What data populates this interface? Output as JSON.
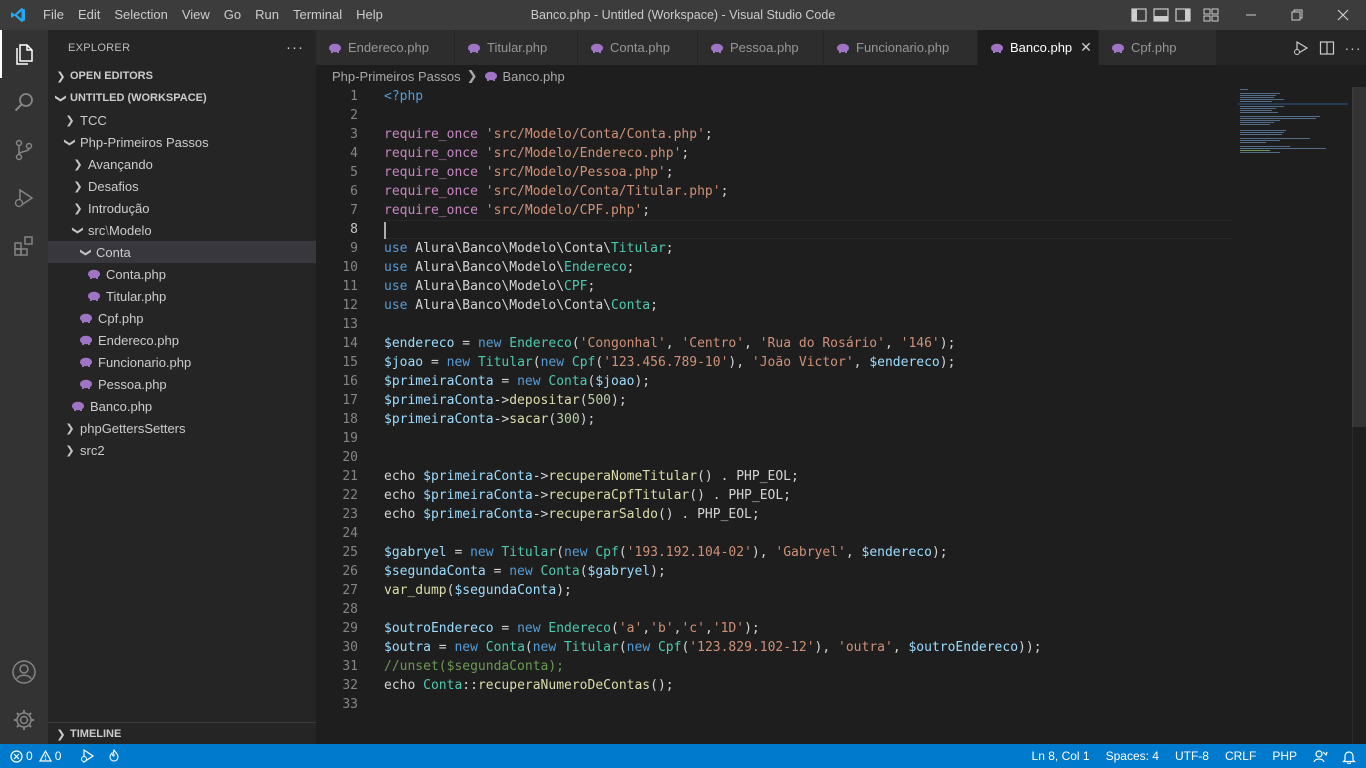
{
  "titlebar": {
    "menu": [
      "File",
      "Edit",
      "Selection",
      "View",
      "Go",
      "Run",
      "Terminal",
      "Help"
    ],
    "title": "Banco.php - Untitled (Workspace) - Visual Studio Code"
  },
  "sidebar": {
    "header": "EXPLORER",
    "open_editors": "OPEN EDITORS",
    "workspace": "UNTITLED (WORKSPACE)",
    "timeline": "TIMELINE",
    "tree": {
      "tcc": "TCC",
      "php_primeiros": "Php-Primeiros Passos",
      "avancando": "Avançando",
      "desafios": "Desafios",
      "introducao": "Introdução",
      "src": "src",
      "modelo": "Modelo",
      "conta_folder": "Conta",
      "conta_php": "Conta.php",
      "titular_php": "Titular.php",
      "cpf_php": "Cpf.php",
      "endereco_php": "Endereco.php",
      "funcionario_php": "Funcionario.php",
      "pessoa_php": "Pessoa.php",
      "banco_php": "Banco.php",
      "getters": "phpGettersSetters",
      "src2": "src2"
    }
  },
  "tabs": [
    "Endereco.php",
    "Titular.php",
    "Conta.php",
    "Pessoa.php",
    "Funcionario.php",
    "Banco.php",
    "Cpf.php"
  ],
  "active_tab": "Banco.php",
  "breadcrumb": {
    "folder": "Php-Primeiros Passos",
    "file": "Banco.php"
  },
  "editor": {
    "line_numbers": [
      "1",
      "2",
      "3",
      "4",
      "5",
      "6",
      "7",
      "8",
      "9",
      "10",
      "11",
      "12",
      "13",
      "14",
      "15",
      "16",
      "17",
      "18",
      "19",
      "20",
      "21",
      "22",
      "23",
      "24",
      "25",
      "26",
      "27",
      "28",
      "29",
      "30",
      "31",
      "32",
      "33"
    ],
    "current_line": 8
  },
  "status": {
    "errors": "0",
    "warnings": "0",
    "position": "Ln 8, Col 1",
    "spaces": "Spaces: 4",
    "encoding": "UTF-8",
    "eol": "CRLF",
    "language": "PHP"
  },
  "colors": {
    "accent": "#007acc",
    "keyword": "#569cd6",
    "string": "#ce9178",
    "variable": "#9cdcfe",
    "class": "#4ec9b0",
    "function": "#dcdcaa",
    "comment": "#6a9955"
  }
}
